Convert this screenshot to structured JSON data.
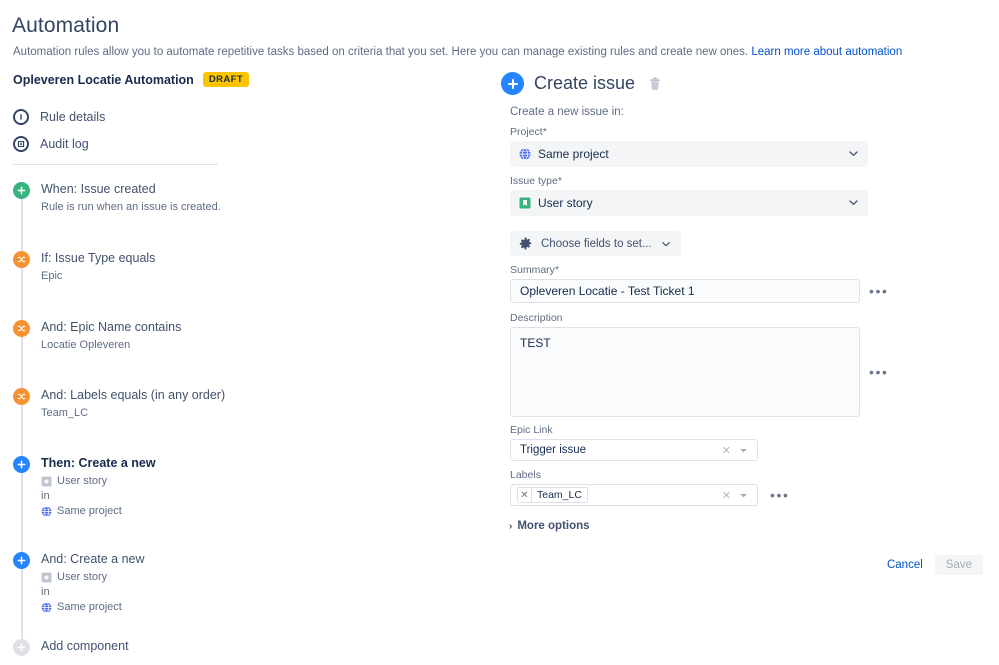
{
  "header": {
    "title": "Automation",
    "description": "Automation rules allow you to automate repetitive tasks based on criteria that you set. Here you can manage existing rules and create new ones.",
    "learn_more_link": "Learn more about automation"
  },
  "rule": {
    "name": "Opleveren Locatie Automation",
    "status_badge": "DRAFT"
  },
  "nav": {
    "items": [
      {
        "label": "Rule details",
        "icon": "info-circle-icon"
      },
      {
        "label": "Audit log",
        "icon": "list-circle-icon"
      }
    ]
  },
  "steps": [
    {
      "title": "When: Issue created",
      "subtitle": "Rule is run when an issue is created.",
      "icon": "plus-circle-icon",
      "icon_color": "#36b37e",
      "bold": false
    },
    {
      "title": "If: Issue Type equals",
      "subtitle": "Epic",
      "icon": "branch-circle-icon",
      "icon_color": "#f79232",
      "bold": false
    },
    {
      "title": "And: Epic Name contains",
      "subtitle": "Locatie Opleveren",
      "icon": "branch-circle-icon",
      "icon_color": "#f79232",
      "bold": false
    },
    {
      "title": "And: Labels equals (in any order)",
      "subtitle": "Team_LC",
      "icon": "branch-circle-icon",
      "icon_color": "#f79232",
      "bold": false
    },
    {
      "title": "Then: Create a new",
      "icon": "plus-circle-icon",
      "icon_color": "#2684ff",
      "bold": true,
      "issue_type": "User story",
      "in_word": "in",
      "project": "Same project"
    },
    {
      "title": "And: Create a new",
      "icon": "plus-circle-icon",
      "icon_color": "#2684ff",
      "bold": false,
      "issue_type": "User story",
      "in_word": "in",
      "project": "Same project"
    },
    {
      "title": "Add component",
      "icon": "plus-circle-icon",
      "icon_color": "#dfe1e6",
      "bold": false
    }
  ],
  "panel": {
    "title": "Create issue",
    "delete_icon": "trash-icon",
    "intro": "Create a new issue in:",
    "project": {
      "label": "Project",
      "required": "*",
      "value": "Same project",
      "icon": "globe-icon"
    },
    "issue_type": {
      "label": "Issue type",
      "required": "*",
      "value": "User story",
      "icon": "bookmark-icon"
    },
    "choose_fields": {
      "label": "Choose fields to set...",
      "icon": "gear-icon"
    },
    "summary": {
      "label": "Summary",
      "required": "*",
      "value": "Opleveren Locatie - Test Ticket 1",
      "more_icon": "ellipsis-icon"
    },
    "description": {
      "label": "Description",
      "value": "TEST",
      "more_icon": "ellipsis-icon"
    },
    "epic_link": {
      "label": "Epic Link",
      "value": "Trigger issue",
      "clear_icon": "clear-x-icon",
      "caret_icon": "caret-down-icon"
    },
    "labels": {
      "label": "Labels",
      "chips": [
        "Team_LC"
      ],
      "clear_icon": "clear-x-icon",
      "caret_icon": "caret-down-icon",
      "more_icon": "ellipsis-icon"
    },
    "more_options": "More options",
    "cancel": "Cancel",
    "save": "Save"
  },
  "colors": {
    "accent_blue": "#0052cc",
    "trigger_green": "#36b37e",
    "condition_orange": "#f79232",
    "action_blue": "#2684ff",
    "draft_amber": "#ffc400"
  }
}
